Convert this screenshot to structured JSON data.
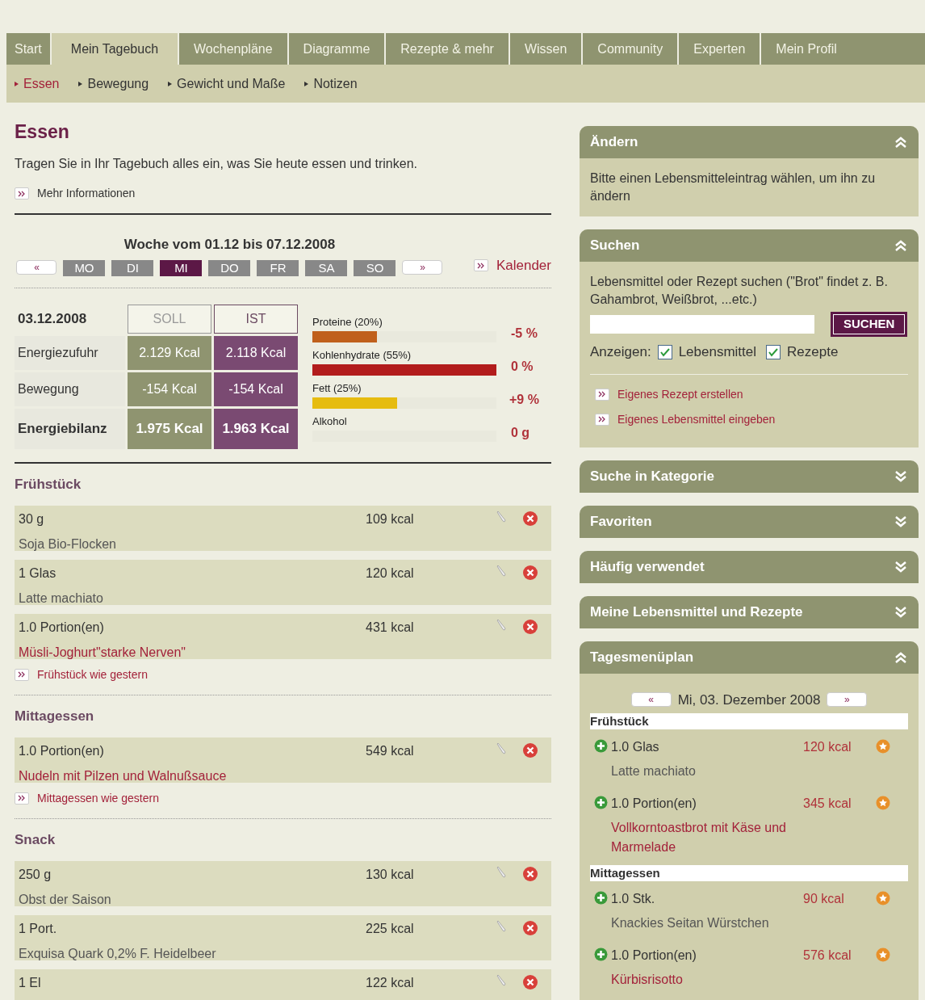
{
  "nav_tabs": [
    {
      "label": "Start",
      "selected": false
    },
    {
      "label": "Mein Tagebuch",
      "selected": true
    },
    {
      "label": "Wochenpläne",
      "selected": false
    },
    {
      "label": "Diagramme",
      "selected": false
    },
    {
      "label": "Rezepte & mehr",
      "selected": false
    },
    {
      "label": "Wissen",
      "selected": false
    },
    {
      "label": "Community",
      "selected": false
    },
    {
      "label": "Experten",
      "selected": false
    },
    {
      "label": "Mein Profil",
      "selected": false
    }
  ],
  "sub_nav": [
    {
      "label": "Essen",
      "selected": true
    },
    {
      "label": "Bewegung",
      "selected": false
    },
    {
      "label": "Gewicht und Maße",
      "selected": false
    },
    {
      "label": "Notizen",
      "selected": false
    }
  ],
  "page_title": "Essen",
  "intro": "Tragen Sie in Ihr Tagebuch alles ein, was Sie heute essen und trinken.",
  "more_link": "Mehr Informationen",
  "week": {
    "title": "Woche vom 01.12 bis 07.12.2008",
    "prev": "«",
    "next": "»",
    "days": [
      {
        "label": "MO",
        "selected": false
      },
      {
        "label": "DI",
        "selected": false
      },
      {
        "label": "MI",
        "selected": true
      },
      {
        "label": "DO",
        "selected": false
      },
      {
        "label": "FR",
        "selected": false
      },
      {
        "label": "SA",
        "selected": false
      },
      {
        "label": "SO",
        "selected": false
      }
    ],
    "calendar_link": "Kalender"
  },
  "balance": {
    "date": "03.12.2008",
    "col_soll": "SOLL",
    "col_ist": "IST",
    "rows": [
      {
        "label": "Energiezufuhr",
        "soll": "2.129 Kcal",
        "ist": "2.118 Kcal",
        "bold": false
      },
      {
        "label": "Bewegung",
        "soll": "-154 Kcal",
        "ist": "-154 Kcal",
        "bold": false
      },
      {
        "label": "Energiebilanz",
        "soll": "1.975 Kcal",
        "ist": "1.963 Kcal",
        "bold": true
      }
    ]
  },
  "macros": [
    {
      "label": "Proteine (20%)",
      "level": 0.35,
      "color": "#c0601c",
      "reading": "-5 %"
    },
    {
      "label": "Kohlenhydrate (55%)",
      "level": 1,
      "color": "#b21c1c",
      "reading": "0 %"
    },
    {
      "label": "Fett (25%)",
      "level": 0.46,
      "color": "#e6bc10",
      "reading": "+9 %"
    },
    {
      "label": "Alkohol",
      "reading": "0 g"
    }
  ],
  "meals": [
    {
      "title": "Frühstück",
      "entries": [
        {
          "amount": "30 g",
          "kcal": "109 kcal",
          "name": "Soja Bio-Flocken",
          "kind": "food"
        },
        {
          "amount": "1 Glas",
          "kcal": "120 kcal",
          "name": "Latte machiato",
          "kind": "food"
        },
        {
          "amount": "1.0 Portion(en)",
          "kcal": "431 kcal",
          "name": "Müsli-Joghurt\"starke Nerven\"",
          "kind": "recipe"
        }
      ],
      "link": "Frühstück wie gestern"
    },
    {
      "title": "Mittagessen",
      "entries": [
        {
          "amount": "1.0 Portion(en)",
          "kcal": "549 kcal",
          "name": "Nudeln mit Pilzen und Walnußsauce",
          "kind": "recipe"
        }
      ],
      "link": "Mittagessen wie gestern"
    },
    {
      "title": "Snack",
      "entries": [
        {
          "amount": "250 g",
          "kcal": "130 kcal",
          "name": "Obst der Saison",
          "kind": "food"
        },
        {
          "amount": "1 Port.",
          "kcal": "225 kcal",
          "name": "Exquisa Quark 0,2% F. Heidelbeer",
          "kind": "food"
        },
        {
          "amount": "1 El",
          "kcal": "122 kcal"
        }
      ]
    }
  ],
  "panels": [
    {
      "title": "Ändern",
      "expanded": true,
      "kind": "text",
      "text": "Bitte einen Lebensmitteleintrag wählen, um ihn zu ändern"
    },
    {
      "title": "Suchen",
      "expanded": true,
      "kind": "search",
      "text": "Lebensmittel oder Rezept suchen (\"Brot\" findet z. B. Gahambrot, Weißbrot, ...etc.)",
      "button": "SUCHEN",
      "show_label": "Anzeigen:",
      "filters": [
        {
          "label": "Lebensmittel",
          "checked": true
        },
        {
          "label": "Rezepte",
          "checked": true
        }
      ],
      "links": [
        "Eigenes Rezept erstellen",
        "Eigenes Lebensmittel eingeben"
      ]
    },
    {
      "title": "Suche in Kategorie",
      "expanded": false
    },
    {
      "title": "Favoriten",
      "expanded": false
    },
    {
      "title": "Häufig verwendet",
      "expanded": false
    },
    {
      "title": "Meine Lebensmittel und Rezepte",
      "expanded": false
    },
    {
      "title": "Tagesmenüplan",
      "expanded": true,
      "kind": "plan",
      "prev": "«",
      "next": "»",
      "date": "Mi, 03. Dezember 2008",
      "sections": [
        {
          "title": "Frühstück",
          "items": [
            {
              "amount": "1.0 Glas",
              "kcal": "120 kcal",
              "name": "Latte machiato",
              "kind": "food"
            },
            {
              "amount": "1.0 Portion(en)",
              "kcal": "345 kcal",
              "name": "Vollkorntoastbrot mit Käse und Marmelade",
              "kind": "recipe"
            }
          ]
        },
        {
          "title": "Mittagessen",
          "items": [
            {
              "amount": "1.0 Stk.",
              "kcal": "90 kcal",
              "name": "Knackies Seitan Würstchen",
              "kind": "food"
            },
            {
              "amount": "1.0 Portion(en)",
              "kcal": "576 kcal",
              "name": "Kürbisrisotto",
              "kind": "recipe"
            }
          ]
        }
      ]
    }
  ]
}
